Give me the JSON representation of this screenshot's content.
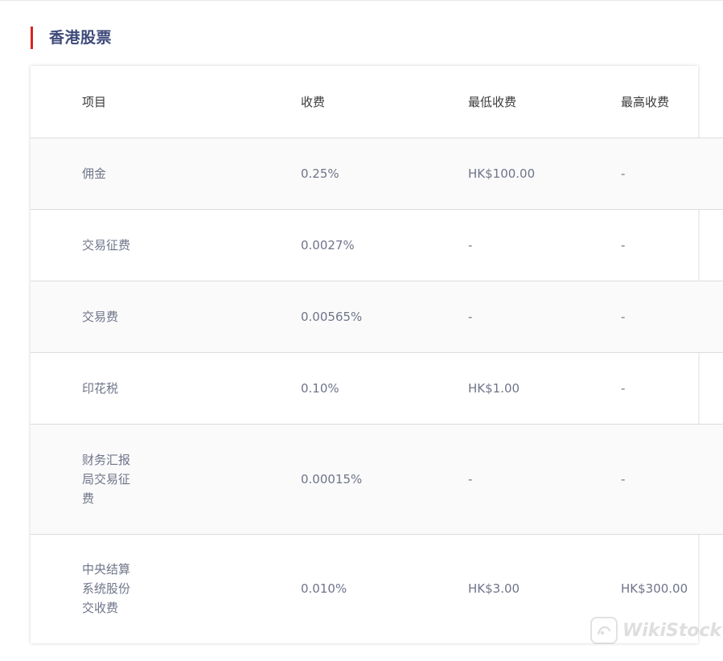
{
  "section": {
    "title": "香港股票",
    "accent_color": "#d7261e",
    "title_color": "#3e4a7a"
  },
  "table": {
    "headers": [
      "项目",
      "收费",
      "最低收费",
      "最高收费"
    ],
    "rows": [
      {
        "item": "佣金",
        "fee": "0.25%",
        "min": "HK$100.00",
        "max": "-"
      },
      {
        "item": "交易征费",
        "fee": "0.0027%",
        "min": "-",
        "max": "-"
      },
      {
        "item": "交易费",
        "fee": "0.00565%",
        "min": "-",
        "max": "-"
      },
      {
        "item": "印花税",
        "fee": "0.10%",
        "min": "HK$1.00",
        "max": "-"
      },
      {
        "item": "财务汇报局交易征费",
        "fee": "0.00015%",
        "min": "-",
        "max": "-"
      },
      {
        "item": "中央结算系统股份交收费",
        "fee": "0.010%",
        "min": "HK$3.00",
        "max": "HK$300.00"
      }
    ]
  },
  "watermark": {
    "text": "WikiStock",
    "icon": "wikistock-logo-icon"
  }
}
